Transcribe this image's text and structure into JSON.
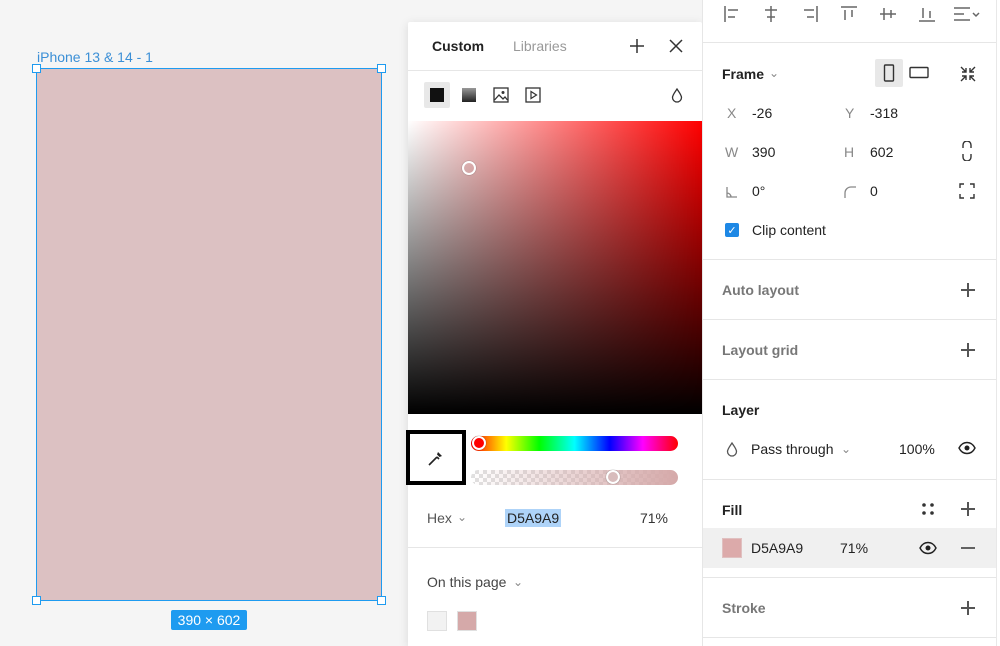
{
  "canvas": {
    "frame_label": "iPhone 13 & 14 - 1",
    "dimensions_badge": "390 × 602",
    "frame_color": "#D5A9A9"
  },
  "picker": {
    "tabs": [
      "Custom",
      "Libraries"
    ],
    "hex_label": "Hex",
    "hex_value": "D5A9A9",
    "opacity": "71%",
    "on_this_page": "On this page",
    "accent": "#1E9BF0"
  },
  "props": {
    "frame_title": "Frame",
    "x_label": "X",
    "x_value": "-26",
    "y_label": "Y",
    "y_value": "-318",
    "w_label": "W",
    "w_value": "390",
    "h_label": "H",
    "h_value": "602",
    "rotation": "0°",
    "radius": "0",
    "clip_content": "Clip content",
    "auto_layout": "Auto layout",
    "layout_grid": "Layout grid",
    "layer_title": "Layer",
    "blend_mode": "Pass through",
    "layer_opacity": "100%",
    "fill_title": "Fill",
    "fill_hex": "D5A9A9",
    "fill_opacity": "71%",
    "stroke_title": "Stroke"
  }
}
